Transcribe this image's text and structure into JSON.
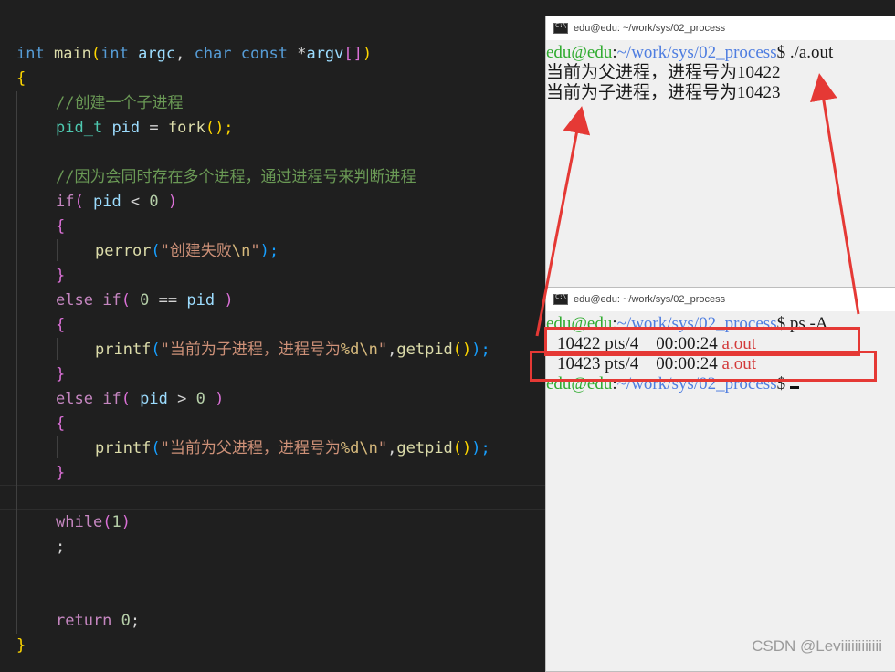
{
  "editor": {
    "lines": [
      {
        "kind": "main",
        "t": [
          "int",
          " ",
          "main",
          "(",
          "int",
          " ",
          "argc",
          ", ",
          "char",
          " ",
          "const",
          " *",
          "argv",
          "[]",
          ")"
        ]
      },
      {
        "kind": "brace_open"
      },
      {
        "kind": "comment",
        "text": "//创建一个子进程"
      },
      {
        "kind": "fork",
        "t": [
          "pid_t",
          " ",
          "pid",
          " = ",
          "fork",
          "();"
        ]
      },
      {
        "kind": "blank"
      },
      {
        "kind": "comment",
        "text": "//因为会同时存在多个进程，通过进程号来判断进程"
      },
      {
        "kind": "if1",
        "t": [
          "if",
          "( ",
          "pid",
          " < ",
          "0",
          " )"
        ]
      },
      {
        "kind": "inner_open"
      },
      {
        "kind": "perror",
        "t": [
          "perror",
          "(",
          "\"创建失败",
          "\\n",
          "\"",
          ");"
        ]
      },
      {
        "kind": "inner_close"
      },
      {
        "kind": "elif1",
        "t": [
          "else",
          " ",
          "if",
          "( ",
          "0",
          " == ",
          "pid",
          " )"
        ]
      },
      {
        "kind": "inner_open"
      },
      {
        "kind": "printf1",
        "t": [
          "printf",
          "(",
          "\"当前为子进程，进程号为",
          "%d",
          "\\n",
          "\"",
          ",",
          "getpid",
          "()",
          ");"
        ]
      },
      {
        "kind": "inner_close"
      },
      {
        "kind": "elif2",
        "t": [
          "else",
          " ",
          "if",
          "( ",
          "pid",
          " > ",
          "0",
          " )"
        ]
      },
      {
        "kind": "inner_open"
      },
      {
        "kind": "printf2",
        "t": [
          "printf",
          "(",
          "\"当前为父进程，进程号为",
          "%d",
          "\\n",
          "\"",
          ",",
          "getpid",
          "()",
          ");"
        ]
      },
      {
        "kind": "inner_close"
      },
      {
        "kind": "blank"
      },
      {
        "kind": "while",
        "t": [
          "while",
          "(",
          "1",
          ")"
        ]
      },
      {
        "kind": "semi",
        "text": ";"
      },
      {
        "kind": "blank"
      },
      {
        "kind": "blank"
      },
      {
        "kind": "return",
        "t": [
          "return",
          " ",
          "0",
          ";"
        ]
      },
      {
        "kind": "brace_close"
      }
    ]
  },
  "terminal_top": {
    "title": "edu@edu: ~/work/sys/02_process",
    "prompt_user": "edu@edu",
    "prompt_path": "~/work/sys/02_process",
    "prompt_cmd": "$ ./a.out",
    "out1": "当前为父进程，进程号为10422",
    "out2": "当前为子进程，进程号为10423"
  },
  "terminal_bottom": {
    "title": "edu@edu: ~/work/sys/02_process",
    "prompt_user": "edu@edu",
    "prompt_path": "~/work/sys/02_process",
    "prompt_cmd": "$ ps -A",
    "rows": [
      {
        "pid": "10422",
        "tty": "pts/4",
        "time": "00:00:24",
        "cmd": "a.out"
      },
      {
        "pid": "10423",
        "tty": "pts/4",
        "time": "00:00:24",
        "cmd": "a.out"
      }
    ],
    "prompt2_user": "edu@edu",
    "prompt2_path": "~/work/sys/02_process",
    "prompt2_dollar": "$ "
  },
  "watermark": "CSDN @Leviiiiiiiiiiii"
}
